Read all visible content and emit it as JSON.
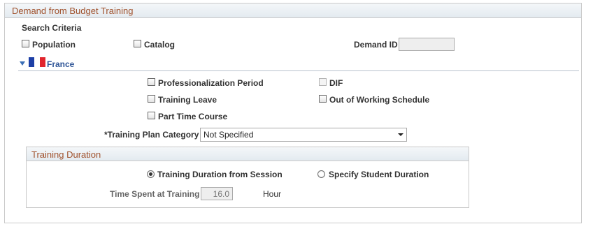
{
  "group_title": "Demand from Budget Training",
  "search_criteria": {
    "heading": "Search Criteria",
    "population_label": "Population",
    "catalog_label": "Catalog",
    "demand_id_label": "Demand ID",
    "demand_id_value": ""
  },
  "country": {
    "name": "France",
    "flag_colors": [
      "#1d3fa6",
      "#ffffff",
      "#e1252d"
    ]
  },
  "france_options": {
    "professionalization_period": "Professionalization Period",
    "training_leave": "Training Leave",
    "part_time_course": "Part Time Course",
    "dif": "DIF",
    "out_of_working_schedule": "Out of Working Schedule"
  },
  "training_plan": {
    "label": "*Training Plan Category",
    "selected": "Not Specified"
  },
  "training_duration": {
    "title": "Training Duration",
    "from_session_label": "Training Duration from Session",
    "specify_student_label": "Specify Student Duration",
    "selected": "from_session",
    "time_spent_label": "Time Spent at Training",
    "time_spent_value": "16.0",
    "unit": "Hour"
  },
  "colors": {
    "group_title": "#a0522d",
    "country_link": "#2f5597"
  }
}
